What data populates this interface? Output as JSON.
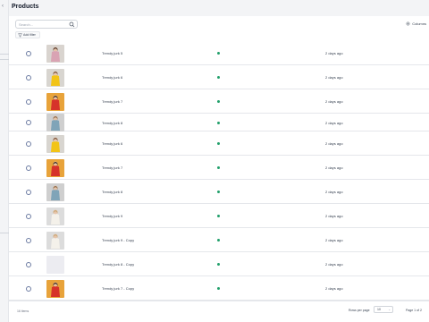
{
  "page": {
    "title": "Products"
  },
  "toolbar": {
    "search_placeholder": "Search...",
    "filter_label": "Add filter",
    "columns_label": "Columns"
  },
  "rows": [
    {
      "name": "Trendy jurk 5",
      "date": "2 days ago",
      "status_color": "#22a06b",
      "thumb": "pink-dress"
    },
    {
      "name": "Trendy jurk 6",
      "date": "2 days ago",
      "status_color": "#22a06b",
      "thumb": "yellow-top"
    },
    {
      "name": "Trendy jurk 7",
      "date": "2 days ago",
      "status_color": "#22a06b",
      "thumb": "red-dress"
    },
    {
      "name": "Trendy jurk 8",
      "date": "2 days ago",
      "status_color": "#22a06b",
      "thumb": "denim-jacket"
    },
    {
      "name": "Trendy jurk 6",
      "date": "2 days ago",
      "status_color": "#22a06b",
      "thumb": "yellow-top"
    },
    {
      "name": "Trendy jurk 7",
      "date": "2 days ago",
      "status_color": "#22a06b",
      "thumb": "red-dress"
    },
    {
      "name": "Trendy jurk 8",
      "date": "2 days ago",
      "status_color": "#22a06b",
      "thumb": "denim-jacket"
    },
    {
      "name": "Trendy jurk 9",
      "date": "2 days ago",
      "status_color": "#22a06b",
      "thumb": "white-outfit"
    },
    {
      "name": "Trendy jurk 9 - Copy",
      "date": "2 days ago",
      "status_color": "#22a06b",
      "thumb": "white-outfit"
    },
    {
      "name": "Trendy jurk 8 - Copy",
      "date": "2 days ago",
      "status_color": "#22a06b",
      "thumb": "placeholder"
    },
    {
      "name": "Trendy jurk 7 - Copy",
      "date": "2 days ago",
      "status_color": "#22a06b",
      "thumb": "red-dress"
    }
  ],
  "footer": {
    "count": "16 items",
    "rows_per_page_label": "Rows per page",
    "rows_per_page_value": "10",
    "page_label": "Page 1 of 2"
  }
}
